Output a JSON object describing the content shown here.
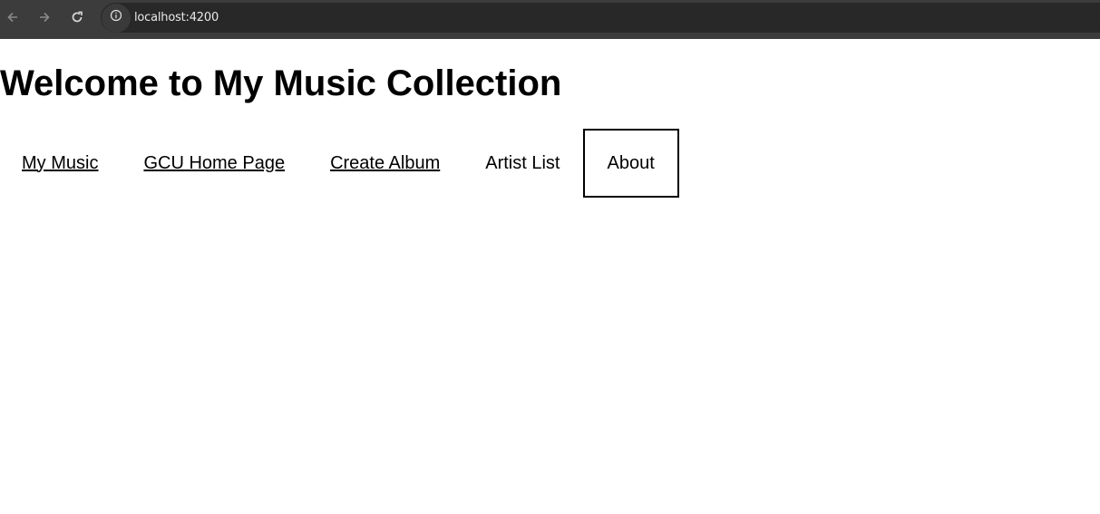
{
  "browser": {
    "url": "localhost:4200",
    "back_icon": "arrow-left-icon",
    "forward_icon": "arrow-right-icon",
    "reload_icon": "reload-icon",
    "site_info_icon": "info-icon"
  },
  "page": {
    "title": "Welcome to My Music Collection"
  },
  "nav": {
    "items": [
      {
        "label": "My Music",
        "link": true
      },
      {
        "label": "GCU Home Page",
        "link": true
      },
      {
        "label": "Create Album",
        "link": true
      },
      {
        "label": "Artist List",
        "link": false
      },
      {
        "label": "About",
        "link": false,
        "selected": true
      }
    ]
  }
}
